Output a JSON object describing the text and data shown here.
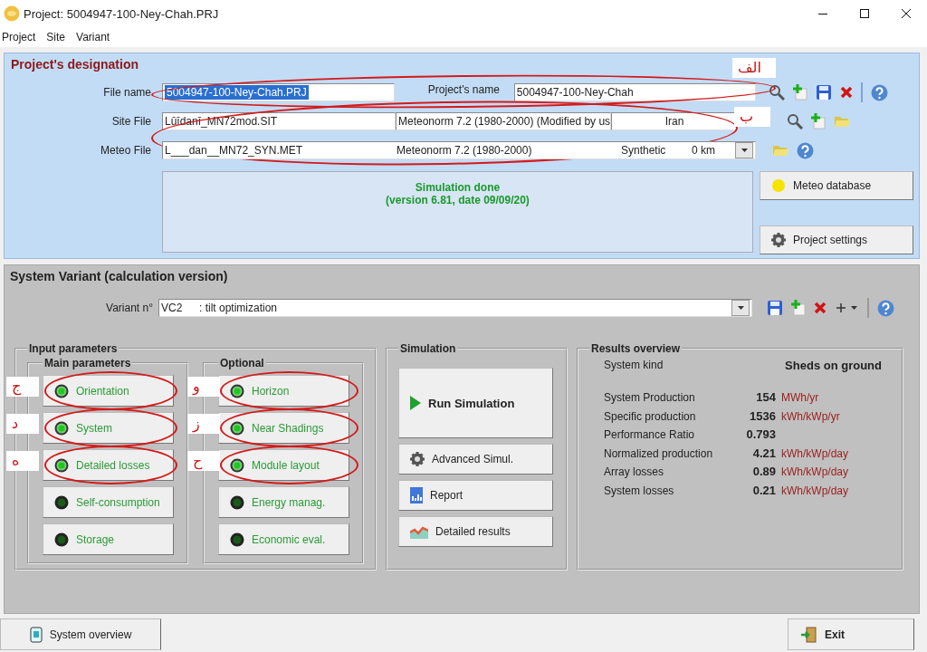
{
  "window": {
    "title": "Project:  5004947-100-Ney-Chah.PRJ"
  },
  "menu": [
    "Project",
    "Site",
    "Variant"
  ],
  "project_designation": {
    "title": "Project's designation",
    "file_row": {
      "label": "File name",
      "value": "5004947-100-Ney-Chah.PRJ",
      "value_selected": true,
      "name_label": "Project's name",
      "name_value": "5004947-100-Ney-Chah",
      "annotation": "الف"
    },
    "site_row": {
      "label": "Site File",
      "file": "Lūīdanī_MN72mod.SIT",
      "source": "Meteonorm 7.2 (1980-2000) (Modified by us",
      "country": "Iran",
      "annotation": "ب"
    },
    "meteo_row": {
      "label": "Meteo File",
      "file": "L___dan__MN72_SYN.MET",
      "source": "Meteonorm 7.2 (1980-2000)",
      "type": "Synthetic",
      "distance": "0 km"
    },
    "status": [
      "Simulation done",
      "(version 6.81, date 09/09/20)"
    ],
    "buttons": [
      {
        "label": "Meteo database"
      },
      {
        "label": "Project settings"
      }
    ]
  },
  "system_variant": {
    "title": "System Variant (calculation version)",
    "variant_label": "Variant n°",
    "variant_code": "VC2",
    "variant_name": ": tilt optimization",
    "input_parameters": {
      "title": "Input parameters",
      "groups": [
        {
          "title": "Main parameters",
          "buttons": [
            {
              "label": "Orientation",
              "lit": true,
              "annotation": "ج"
            },
            {
              "label": "System",
              "lit": true,
              "annotation": "د"
            },
            {
              "label": "Detailed losses",
              "lit": true,
              "annotation": "ه"
            },
            {
              "label": "Self-consumption",
              "lit": false
            },
            {
              "label": "Storage",
              "lit": false
            }
          ]
        },
        {
          "title": "Optional",
          "buttons": [
            {
              "label": "Horizon",
              "lit": true,
              "annotation": "و"
            },
            {
              "label": "Near Shadings",
              "lit": true,
              "annotation": "ز"
            },
            {
              "label": "Module layout",
              "lit": true,
              "annotation": "ح"
            },
            {
              "label": "Energy manag.",
              "lit": false
            },
            {
              "label": "Economic eval.",
              "lit": false
            }
          ]
        }
      ]
    },
    "simulation": {
      "title": "Simulation",
      "buttons": [
        {
          "label": "Run Simulation"
        },
        {
          "label": "Advanced Simul."
        },
        {
          "label": "Report"
        },
        {
          "label": "Detailed results"
        }
      ]
    },
    "results": {
      "title": "Results overview",
      "system_kind_label": "System kind",
      "system_kind": "Sheds on ground",
      "rows": [
        {
          "label": "System Production",
          "value": "154",
          "unit": "MWh/yr"
        },
        {
          "label": "Specific production",
          "value": "1536",
          "unit": "kWh/kWp/yr"
        },
        {
          "label": "Performance Ratio",
          "value": "0.793"
        },
        {
          "label": "Normalized production",
          "value": "4.21",
          "unit": "kWh/kWp/day"
        },
        {
          "label": "Array losses",
          "value": "0.89",
          "unit": "kWh/kWp/day"
        },
        {
          "label": "System losses",
          "value": "0.21",
          "unit": "kWh/kWp/day"
        }
      ]
    }
  },
  "bottom_bar": {
    "left_button": "System overview",
    "right_button": "Exit"
  }
}
